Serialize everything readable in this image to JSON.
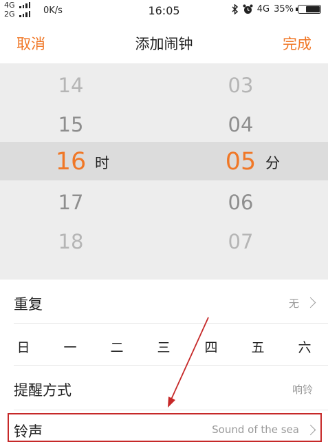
{
  "status_bar": {
    "net_top": "4G",
    "net_bottom": "2G",
    "speed": "0K/s",
    "time": "16:05",
    "network": "4G",
    "battery": "35%",
    "battery_level": 0.35
  },
  "header": {
    "cancel_label": "取消",
    "title": "添加闹钟",
    "done_label": "完成",
    "accent_color": "#f07726"
  },
  "picker": {
    "hours": [
      "14",
      "15",
      "16",
      "17",
      "18"
    ],
    "minutes": [
      "03",
      "04",
      "05",
      "06",
      "07"
    ],
    "hour_unit": "时",
    "minute_unit": "分"
  },
  "repeat": {
    "label": "重复",
    "value": "无"
  },
  "weekdays": [
    "日",
    "一",
    "二",
    "三",
    "四",
    "五",
    "六"
  ],
  "reminder": {
    "label": "提醒方式",
    "value": "响铃"
  },
  "ringtone": {
    "label": "铃声",
    "value": "Sound of the sea"
  }
}
